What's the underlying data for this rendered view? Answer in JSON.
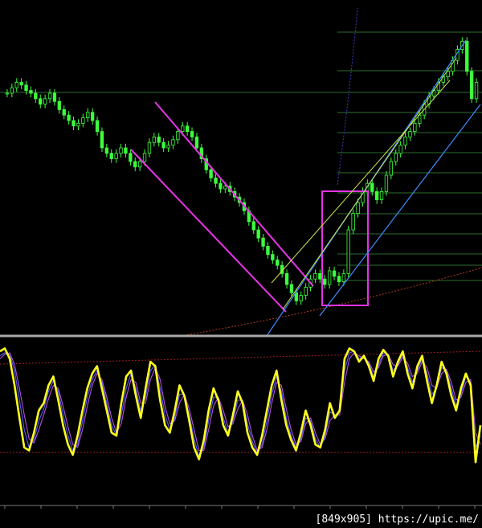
{
  "watermark": "[849x905] https://upic.me/",
  "colors": {
    "background": "#000000",
    "candle": "#3cff3c",
    "separator": "#aaaaaa",
    "hline": "#2e6b2e",
    "channel_magenta": "#e633e6",
    "channel_blue": "#3c8cff",
    "channel_yellow": "#c8e650",
    "box": "#e633e6",
    "ma_dotted": "#b43c1e",
    "osc_yellow": "#ffff1e",
    "osc_blue": "#5a5aff",
    "osc_purple": "#b450dc",
    "osc_level": "#a01e1e"
  },
  "chart_data": [
    {
      "type": "candlestick",
      "panel": "price",
      "title": "",
      "xlabel": "",
      "ylabel": "",
      "grid": false,
      "close_series_relative": [
        0.8,
        0.82,
        0.84,
        0.83,
        0.81,
        0.8,
        0.78,
        0.76,
        0.78,
        0.8,
        0.77,
        0.74,
        0.72,
        0.7,
        0.68,
        0.69,
        0.71,
        0.73,
        0.7,
        0.66,
        0.6,
        0.58,
        0.56,
        0.58,
        0.6,
        0.58,
        0.55,
        0.53,
        0.55,
        0.58,
        0.62,
        0.64,
        0.62,
        0.6,
        0.61,
        0.63,
        0.66,
        0.68,
        0.66,
        0.64,
        0.6,
        0.56,
        0.52,
        0.49,
        0.47,
        0.45,
        0.46,
        0.44,
        0.42,
        0.4,
        0.37,
        0.33,
        0.3,
        0.27,
        0.24,
        0.21,
        0.19,
        0.17,
        0.14,
        0.1,
        0.07,
        0.04,
        0.06,
        0.09,
        0.12,
        0.14,
        0.12,
        0.1,
        0.15,
        0.13,
        0.11,
        0.14,
        0.3,
        0.36,
        0.4,
        0.44,
        0.47,
        0.44,
        0.41,
        0.44,
        0.5,
        0.55,
        0.58,
        0.61,
        0.64,
        0.66,
        0.69,
        0.72,
        0.76,
        0.79,
        0.81,
        0.84,
        0.86,
        0.88,
        0.92,
        0.96,
        0.99,
        0.88,
        0.78,
        0.84
      ],
      "annotations": [
        "descending channel (magenta)",
        "ascending channel (blue)",
        "ascending channel (yellow)",
        "highlight box (magenta)"
      ]
    },
    {
      "type": "line",
      "panel": "oscillator",
      "title": "",
      "ylim": [
        0,
        100
      ],
      "series": [
        {
          "values": [
            95,
            97,
            90,
            72,
            50,
            30,
            28,
            40,
            55,
            60,
            72,
            78,
            62,
            45,
            32,
            25,
            38,
            55,
            70,
            80,
            85,
            70,
            55,
            40,
            38,
            60,
            78,
            82,
            65,
            50,
            70,
            88,
            85,
            62,
            45,
            40,
            55,
            72,
            65,
            48,
            30,
            22,
            35,
            55,
            70,
            62,
            45,
            38,
            52,
            68,
            60,
            40,
            30,
            25,
            38,
            55,
            72,
            82,
            62,
            45,
            35,
            28,
            40,
            55,
            45,
            32,
            30,
            42,
            60,
            50,
            55,
            90,
            97,
            95,
            88,
            92,
            85,
            75,
            90,
            96,
            92,
            78,
            88,
            95,
            80,
            70,
            85,
            92,
            75,
            60,
            72,
            88,
            80,
            65,
            55,
            70,
            80,
            72,
            20,
            45
          ]
        },
        {
          "values": [
            92,
            94,
            93,
            82,
            62,
            42,
            30,
            35,
            48,
            56,
            68,
            75,
            68,
            52,
            38,
            28,
            32,
            48,
            64,
            76,
            82,
            74,
            60,
            45,
            38,
            52,
            70,
            80,
            70,
            55,
            64,
            82,
            86,
            70,
            52,
            42,
            50,
            66,
            66,
            52,
            36,
            24,
            30,
            48,
            64,
            64,
            50,
            40,
            48,
            62,
            62,
            46,
            34,
            26,
            32,
            48,
            66,
            78,
            68,
            50,
            38,
            30,
            36,
            50,
            48,
            36,
            30,
            38,
            54,
            52,
            54,
            82,
            94,
            95,
            90,
            91,
            87,
            78,
            86,
            94,
            93,
            82,
            86,
            93,
            84,
            74,
            82,
            90,
            80,
            66,
            70,
            84,
            82,
            70,
            58,
            66,
            78,
            74,
            30,
            38
          ]
        },
        {
          "values": [
            90,
            93,
            94,
            86,
            70,
            52,
            36,
            33,
            42,
            52,
            63,
            72,
            70,
            58,
            44,
            32,
            30,
            42,
            58,
            72,
            80,
            76,
            64,
            50,
            40,
            46,
            64,
            76,
            74,
            60,
            60,
            76,
            84,
            76,
            58,
            46,
            48,
            60,
            66,
            56,
            42,
            28,
            28,
            42,
            58,
            64,
            55,
            44,
            46,
            56,
            62,
            52,
            38,
            28,
            30,
            42,
            60,
            74,
            72,
            56,
            42,
            32,
            34,
            46,
            50,
            40,
            32,
            36,
            48,
            52,
            52,
            74,
            90,
            94,
            92,
            90,
            88,
            81,
            84,
            92,
            93,
            86,
            85,
            91,
            87,
            78,
            80,
            88,
            84,
            72,
            70,
            80,
            83,
            74,
            62,
            64,
            74,
            76,
            40,
            32
          ]
        }
      ]
    }
  ]
}
